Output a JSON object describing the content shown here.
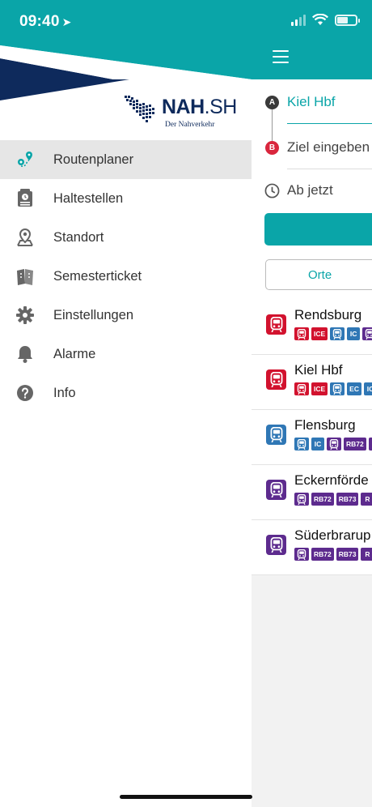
{
  "status_bar": {
    "time": "09:40"
  },
  "drawer": {
    "logo": {
      "name": "NAH",
      "suffix": ".SH",
      "subtitle": "Der Nahverkehr"
    },
    "items": [
      {
        "label": "Routenplaner",
        "icon": "route-icon",
        "active": true
      },
      {
        "label": "Haltestellen",
        "icon": "stop-sign-icon",
        "active": false
      },
      {
        "label": "Standort",
        "icon": "map-pin-icon",
        "active": false
      },
      {
        "label": "Semesterticket",
        "icon": "ticket-icon",
        "active": false
      },
      {
        "label": "Einstellungen",
        "icon": "gear-icon",
        "active": false
      },
      {
        "label": "Alarme",
        "icon": "bell-icon",
        "active": false
      },
      {
        "label": "Info",
        "icon": "question-icon",
        "active": false
      }
    ]
  },
  "planner": {
    "marker_a": "A",
    "marker_b": "B",
    "from": "Kiel Hbf",
    "to_placeholder": "Ziel eingeben",
    "time": "Ab jetzt",
    "tab_places": "Orte"
  },
  "stations": [
    {
      "name": "Rendsburg",
      "type": "red",
      "badges": [
        {
          "t": "",
          "c": "red",
          "icon": "train"
        },
        {
          "t": "ICE",
          "c": "red"
        },
        {
          "t": "",
          "c": "blue",
          "icon": "train"
        },
        {
          "t": "IC",
          "c": "blue"
        },
        {
          "t": "",
          "c": "purple",
          "icon": "train"
        }
      ]
    },
    {
      "name": "Kiel Hbf",
      "type": "red",
      "badges": [
        {
          "t": "",
          "c": "red",
          "icon": "train"
        },
        {
          "t": "ICE",
          "c": "red"
        },
        {
          "t": "",
          "c": "blue",
          "icon": "train"
        },
        {
          "t": "EC",
          "c": "blue"
        },
        {
          "t": "IC",
          "c": "blue"
        }
      ]
    },
    {
      "name": "Flensburg",
      "type": "blue",
      "badges": [
        {
          "t": "",
          "c": "blue",
          "icon": "train"
        },
        {
          "t": "IC",
          "c": "blue"
        },
        {
          "t": "",
          "c": "purple",
          "icon": "train"
        },
        {
          "t": "RB72",
          "c": "purple"
        },
        {
          "t": "",
          "c": "purple"
        }
      ]
    },
    {
      "name": "Eckernförde",
      "type": "purple",
      "badges": [
        {
          "t": "",
          "c": "purple",
          "icon": "train"
        },
        {
          "t": "RB72",
          "c": "purple"
        },
        {
          "t": "RB73",
          "c": "purple"
        },
        {
          "t": "R",
          "c": "purple"
        }
      ]
    },
    {
      "name": "Süderbrarup",
      "type": "purple",
      "badges": [
        {
          "t": "",
          "c": "purple",
          "icon": "train"
        },
        {
          "t": "RB72",
          "c": "purple"
        },
        {
          "t": "RB73",
          "c": "purple"
        },
        {
          "t": "R",
          "c": "purple"
        }
      ]
    }
  ],
  "colors": {
    "teal": "#0aa5a8",
    "navy": "#0e2a5c",
    "red": "#d2122e",
    "blue": "#2f77b5",
    "purple": "#5d2b8e"
  }
}
